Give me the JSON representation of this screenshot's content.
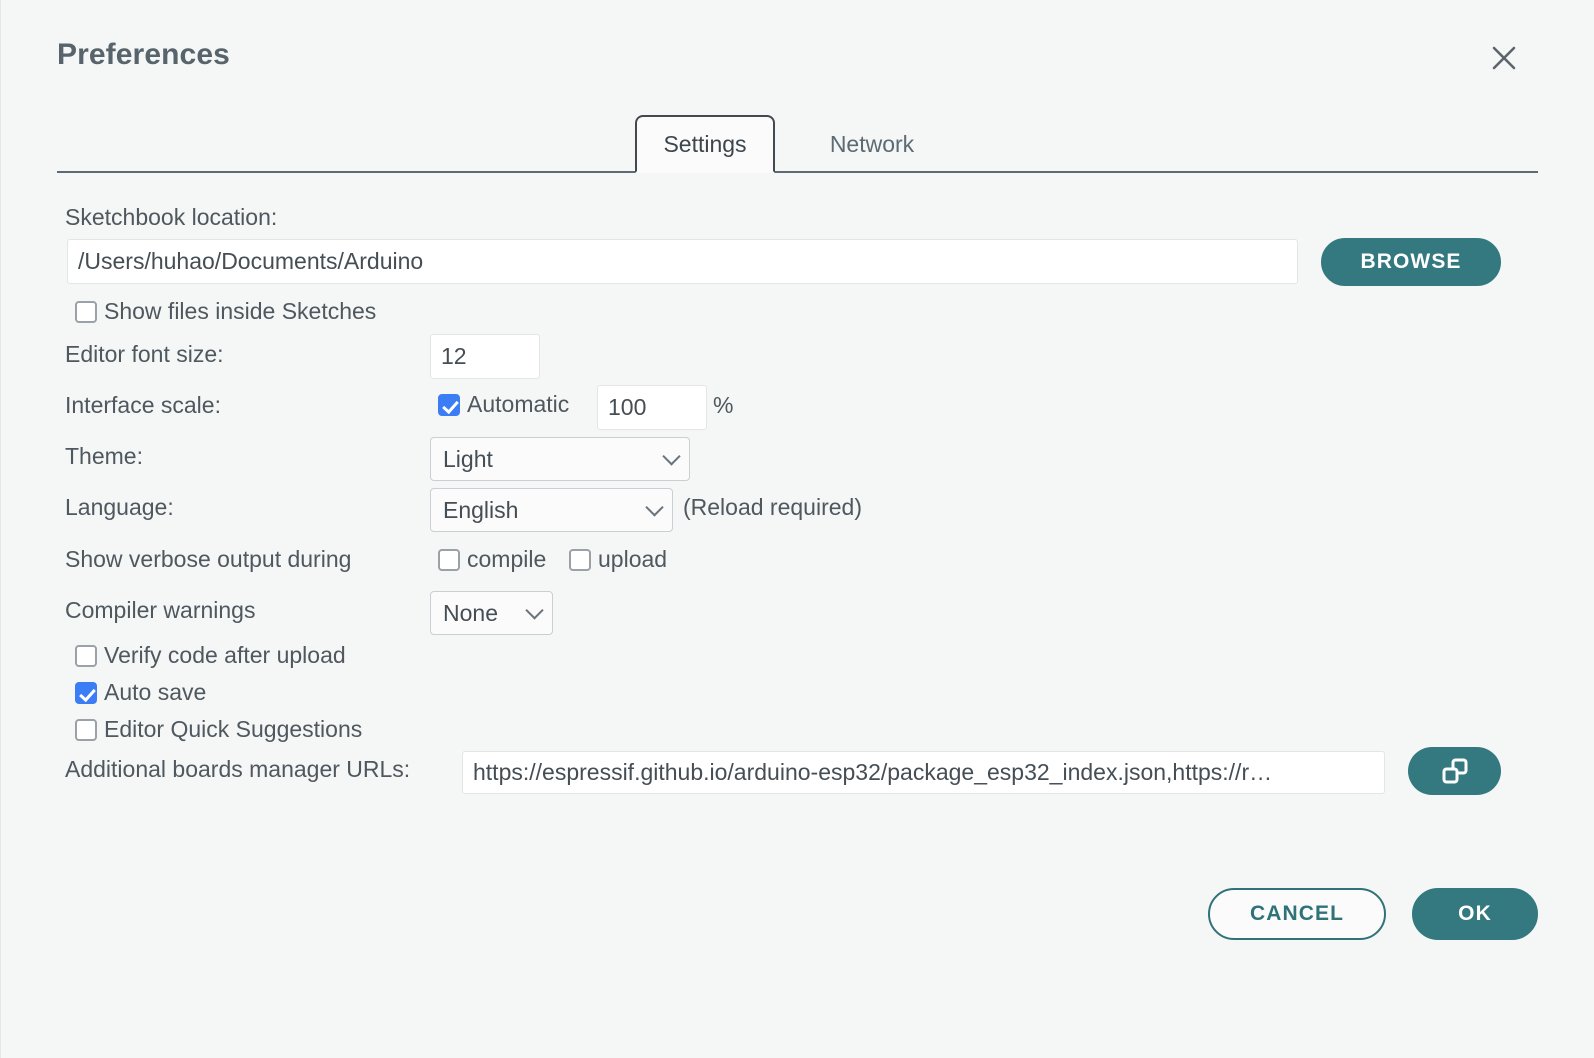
{
  "dialog": {
    "title": "Preferences",
    "close_icon": "close-icon"
  },
  "tabs": [
    {
      "label": "Settings",
      "active": true
    },
    {
      "label": "Network",
      "active": false
    }
  ],
  "settings": {
    "sketchbook": {
      "label": "Sketchbook location:",
      "value": "/Users/huhao/Documents/Arduino",
      "browse_label": "BROWSE"
    },
    "show_files_inside_sketches": {
      "label": "Show files inside Sketches",
      "checked": false
    },
    "editor_font_size": {
      "label": "Editor font size:",
      "value": "12"
    },
    "interface_scale": {
      "label": "Interface scale:",
      "automatic_label": "Automatic",
      "automatic_checked": true,
      "value": "100",
      "unit": "%"
    },
    "theme": {
      "label": "Theme:",
      "value": "Light"
    },
    "language": {
      "label": "Language:",
      "value": "English",
      "note": "(Reload required)"
    },
    "verbose_output": {
      "label": "Show verbose output during",
      "compile_label": "compile",
      "compile_checked": false,
      "upload_label": "upload",
      "upload_checked": false
    },
    "compiler_warnings": {
      "label": "Compiler warnings",
      "value": "None"
    },
    "verify_code_after_upload": {
      "label": "Verify code after upload",
      "checked": false
    },
    "auto_save": {
      "label": "Auto save",
      "checked": true
    },
    "editor_quick_suggestions": {
      "label": "Editor Quick Suggestions",
      "checked": false
    },
    "additional_urls": {
      "label": "Additional boards manager URLs:",
      "value": "https://espressif.github.io/arduino-esp32/package_esp32_index.json,https://r…",
      "expand_icon": "open-windows-icon"
    }
  },
  "footer": {
    "cancel_label": "CANCEL",
    "ok_label": "OK"
  },
  "colors": {
    "accent": "#33797f",
    "checkbox_checked": "#3b7df5",
    "background": "#f5f6f6",
    "text": "#4f585e"
  }
}
